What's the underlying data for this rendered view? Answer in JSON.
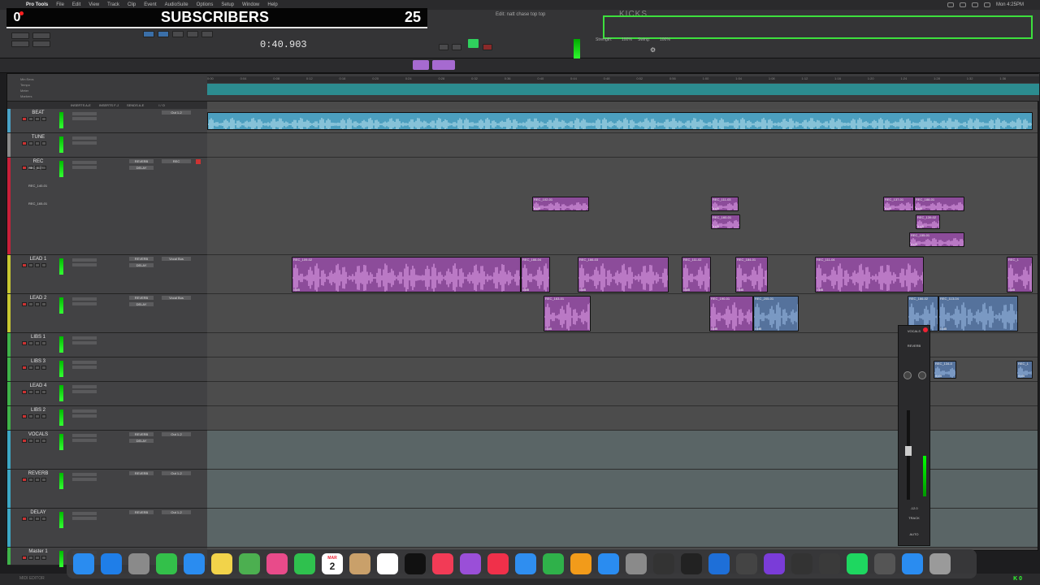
{
  "menubar": {
    "app_name": "Pro Tools",
    "items": [
      "File",
      "Edit",
      "View",
      "Track",
      "Clip",
      "Event",
      "AudioSuite",
      "Options",
      "Setup",
      "Window",
      "Help"
    ],
    "clock": "Mon 4:25PM"
  },
  "overlay": {
    "icon_text": "0",
    "label": "SUBSCRIBERS",
    "count": "25"
  },
  "toolbar": {
    "edit_window_title": "Edit: natt chase top top",
    "kicks_label": "KICKS",
    "main_counter": "0:40.903",
    "strength_label": "Strength:",
    "strength_value": "100%",
    "swing_label": "Swing:",
    "swing_value": "100%"
  },
  "rulers": {
    "labels": [
      "Min:Secs",
      "Tempo",
      "Meter",
      "Markers"
    ],
    "ticks": [
      "0:00",
      "0:04",
      "0:08",
      "0:12",
      "0:16",
      "0:20",
      "0:24",
      "0:28",
      "0:32",
      "0:36",
      "0:40",
      "0:44",
      "0:48",
      "0:52",
      "0:56",
      "1:00",
      "1:04",
      "1:08",
      "1:12",
      "1:16",
      "1:20",
      "1:24",
      "1:28",
      "1:32",
      "1:36"
    ]
  },
  "column_headers": {
    "inserts_ae": "INSERTS A-E",
    "inserts_fj": "INSERTS F-J",
    "sends_ae": "SENDS A-E",
    "io": "I / O"
  },
  "tracks": [
    {
      "name": "BEAT",
      "color": "#4aa3c8",
      "io": "Out 1-2",
      "sends": [],
      "kind": "audio"
    },
    {
      "name": "TUNE",
      "color": "#8a8a8a",
      "io": "",
      "sends": [],
      "kind": "audio"
    },
    {
      "name": "REC",
      "color": "#c8203a",
      "io": "REC",
      "sends": [
        "REVERB",
        "DELAY"
      ],
      "kind": "audio"
    },
    {
      "name": "LEAD 1",
      "color": "#c8c832",
      "io": "Vocal Bus",
      "sends": [
        "REVERB",
        "DELAY"
      ],
      "kind": "audio"
    },
    {
      "name": "LEAD 2",
      "color": "#c8c832",
      "io": "Vocal Bus",
      "sends": [
        "REVERB",
        "DELAY"
      ],
      "kind": "audio"
    },
    {
      "name": "LIBS 1",
      "color": "#3fb34a",
      "io": "",
      "sends": [],
      "kind": "audio"
    },
    {
      "name": "LIBS 3",
      "color": "#3fb34a",
      "io": "",
      "sends": [],
      "kind": "audio"
    },
    {
      "name": "LEAD 4",
      "color": "#3fb34a",
      "io": "",
      "sends": [],
      "kind": "audio"
    },
    {
      "name": "LIBS 2",
      "color": "#3fb34a",
      "io": "",
      "sends": [],
      "kind": "audio"
    },
    {
      "name": "VOCALS",
      "color": "#3da7c5",
      "io": "Out 1-2",
      "sends": [
        "REVERB",
        "DELAY"
      ],
      "kind": "aux"
    },
    {
      "name": "REVERB",
      "color": "#3da7c5",
      "io": "Out 1-2",
      "sends": [
        "REVERB"
      ],
      "kind": "aux"
    },
    {
      "name": "DELAY",
      "color": "#3da7c5",
      "io": "Out 1-2",
      "sends": [
        "REVERB"
      ],
      "kind": "aux"
    },
    {
      "name": "Master 1",
      "color": "#3fb34a",
      "io": "",
      "sends": [],
      "kind": "master"
    }
  ],
  "rec_playlists": [
    "REC_137",
    "REC_140-01",
    "REC_165-01"
  ],
  "clips": {
    "rec": [
      "REC_102-01",
      "REC_111-03",
      "REC_137-01",
      "REC_188-01",
      "REC",
      "REC_160-01",
      "REC_139-02",
      "REC_155-01"
    ],
    "lead1": [
      "REC_109-02",
      "REC_166-04",
      "REC_166-03",
      "REC_111-02",
      "REC_184-01",
      "REC_111-04",
      "REC_1"
    ],
    "lead2": [
      "REC_163-01",
      "REC_190-01",
      "REC_205-01",
      "REC_166-02",
      "REC_113-04"
    ],
    "libs": [
      "REC_134-0",
      "REC_1"
    ],
    "gain": "0 dB"
  },
  "mini_mixer": {
    "track": "VOCALS",
    "send_label": "REVERB",
    "value": "-12.0",
    "track_btn": "TRACK",
    "auto_btn": "AUTO"
  },
  "dock": {
    "apps": [
      "finder-icon",
      "safari-icon",
      "launchpad-icon",
      "messages-icon",
      "mail-icon",
      "notes-icon",
      "maps-icon",
      "photos-icon",
      "facetime-icon",
      "calendar-icon",
      "contacts-icon",
      "reminders-icon",
      "appletv-icon",
      "music-icon",
      "podcasts-icon",
      "news-icon",
      "keynote-icon",
      "numbers-icon",
      "pages-icon",
      "appstore-icon",
      "settings-icon",
      "logic-icon",
      "ilok-icon",
      "ring-icon",
      "waves-icon",
      "avid-icon",
      "uad-icon",
      "soundtoys-icon",
      "spotify-icon",
      "camera-icon",
      "quicktime-icon",
      "trash-icon"
    ],
    "calendar_month": "MAR",
    "calendar_day": "2"
  },
  "statusbar": {
    "text": "MIDI EDITOR"
  },
  "corner_badge": "K 0",
  "colors": {
    "beat_clip": "#4c9fbf",
    "vocal_clip": "#8c4c9a",
    "libs_clip": "#55729c",
    "highlight_box": "#3de03d"
  }
}
